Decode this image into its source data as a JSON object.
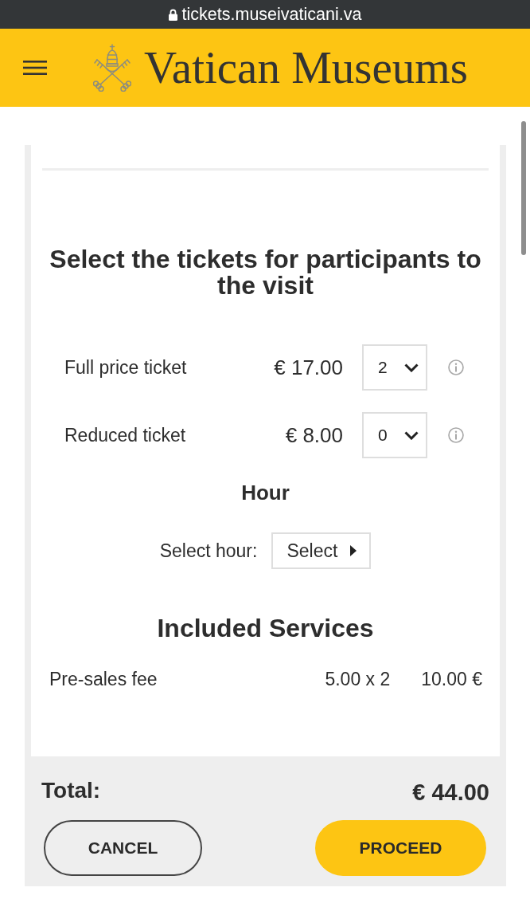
{
  "address_bar": {
    "url": "tickets.museivaticani.va"
  },
  "header": {
    "title": "Vatican Museums"
  },
  "tickets": {
    "heading": "Select the tickets for participants to the visit",
    "rows": [
      {
        "name": "Full price ticket",
        "price": "€ 17.00",
        "quantity": "2"
      },
      {
        "name": "Reduced ticket",
        "price": "€ 8.00",
        "quantity": "0"
      }
    ]
  },
  "hour": {
    "heading": "Hour",
    "label": "Select hour:",
    "button": "Select"
  },
  "services": {
    "heading": "Included Services",
    "rows": [
      {
        "name": "Pre-sales fee",
        "unit": "5.00 x 2",
        "amount": "10.00 €"
      }
    ]
  },
  "footer": {
    "total_label": "Total:",
    "total": "€ 44.00",
    "buttons": [
      {
        "label": "CANCEL",
        "kind": "outline"
      },
      {
        "label": "PROCEED",
        "kind": "primary"
      }
    ]
  }
}
